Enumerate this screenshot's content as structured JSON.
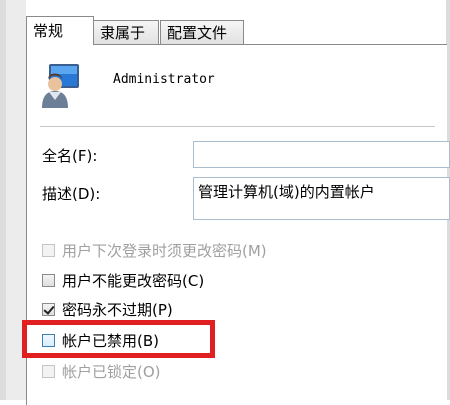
{
  "tabs": [
    {
      "label": "常规"
    },
    {
      "label": "隶属于"
    },
    {
      "label": "配置文件"
    }
  ],
  "user": {
    "name": "Administrator",
    "avatar_icon": "user-account-icon"
  },
  "fields": {
    "fullname_label": "全名(F):",
    "fullname_value": "",
    "description_label": "描述(D):",
    "description_value": "管理计算机(域)的内置帐户"
  },
  "options": [
    {
      "label": "用户下次登录时须更改密码(M)",
      "checked": false,
      "disabled": true
    },
    {
      "label": "用户不能更改密码(C)",
      "checked": false,
      "disabled": false
    },
    {
      "label": "密码永不过期(P)",
      "checked": true,
      "disabled": false
    },
    {
      "label": "帐户已禁用(B)",
      "checked": false,
      "disabled": false
    },
    {
      "label": "帐户已锁定(O)",
      "checked": false,
      "disabled": true
    }
  ],
  "colors": {
    "highlight": "#e02020",
    "field_border": "#a9bcd0"
  }
}
